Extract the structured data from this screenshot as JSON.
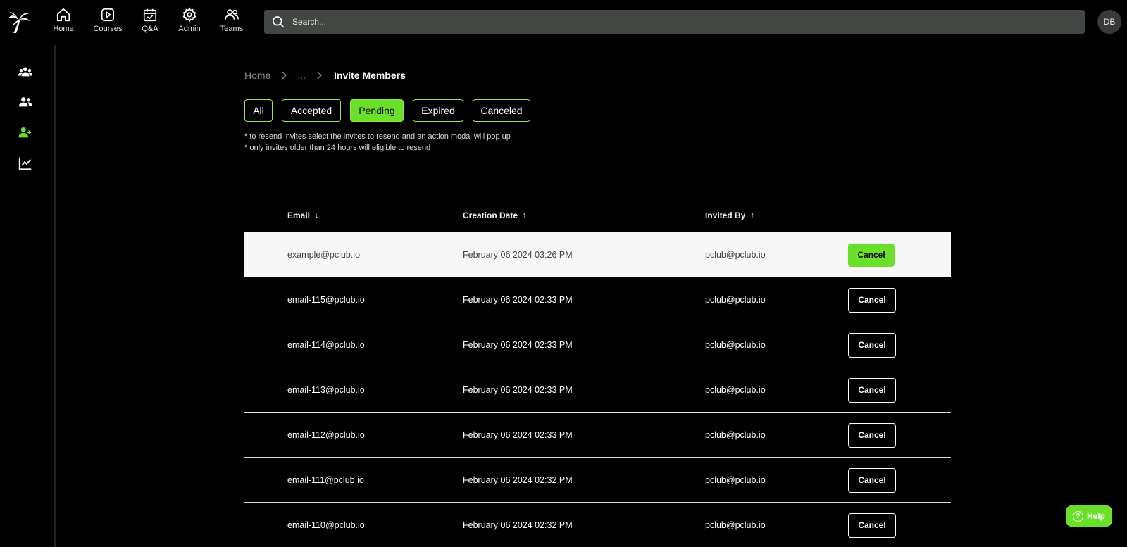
{
  "app": {
    "logo_icon": "palm-tree-icon"
  },
  "nav": [
    {
      "label": "Home",
      "icon": "home-icon"
    },
    {
      "label": "Courses",
      "icon": "play-square-icon"
    },
    {
      "label": "Q&A",
      "icon": "calendar-check-icon"
    },
    {
      "label": "Admin",
      "icon": "gear-icon"
    },
    {
      "label": "Teams",
      "icon": "users-icon"
    }
  ],
  "search": {
    "placeholder": "Search..."
  },
  "user": {
    "initials": "DB"
  },
  "sidebar": [
    {
      "icon": "group-icon",
      "active": false
    },
    {
      "icon": "users-icon",
      "active": false
    },
    {
      "icon": "add-user-icon",
      "active": true
    },
    {
      "icon": "chart-line-icon",
      "active": false
    }
  ],
  "breadcrumb": {
    "home": "Home",
    "ellipsis": "...",
    "current": "Invite Members"
  },
  "tabs": [
    {
      "label": "All",
      "active": false
    },
    {
      "label": "Accepted",
      "active": false
    },
    {
      "label": "Pending",
      "active": true
    },
    {
      "label": "Expired",
      "active": false
    },
    {
      "label": "Canceled",
      "active": false
    }
  ],
  "notes": [
    "* to resend invites select the invites to resend and an action modal will pop up",
    "* only invites older than 24 hours will eligible to resend"
  ],
  "table": {
    "columns": [
      {
        "label": "Email",
        "sort": "↓"
      },
      {
        "label": "Creation Date",
        "sort": "↑"
      },
      {
        "label": "Invited By",
        "sort": "↑"
      }
    ],
    "rows": [
      {
        "email": "example@pclub.io",
        "date": "February 06 2024 03:26 PM",
        "invited_by": "pclub@pclub.io",
        "action": "Cancel",
        "highlight": true
      },
      {
        "email": "email-115@pclub.io",
        "date": "February 06 2024 02:33 PM",
        "invited_by": "pclub@pclub.io",
        "action": "Cancel",
        "highlight": false
      },
      {
        "email": "email-114@pclub.io",
        "date": "February 06 2024 02:33 PM",
        "invited_by": "pclub@pclub.io",
        "action": "Cancel",
        "highlight": false
      },
      {
        "email": "email-113@pclub.io",
        "date": "February 06 2024 02:33 PM",
        "invited_by": "pclub@pclub.io",
        "action": "Cancel",
        "highlight": false
      },
      {
        "email": "email-112@pclub.io",
        "date": "February 06 2024 02:33 PM",
        "invited_by": "pclub@pclub.io",
        "action": "Cancel",
        "highlight": false
      },
      {
        "email": "email-111@pclub.io",
        "date": "February 06 2024 02:32 PM",
        "invited_by": "pclub@pclub.io",
        "action": "Cancel",
        "highlight": false
      },
      {
        "email": "email-110@pclub.io",
        "date": "February 06 2024 02:32 PM",
        "invited_by": "pclub@pclub.io",
        "action": "Cancel",
        "highlight": false
      }
    ]
  },
  "help": {
    "label": "Help",
    "icon": "question-circle-icon"
  },
  "colors": {
    "accent": "#6be02a",
    "background": "#000000",
    "search_bg": "#434743"
  }
}
